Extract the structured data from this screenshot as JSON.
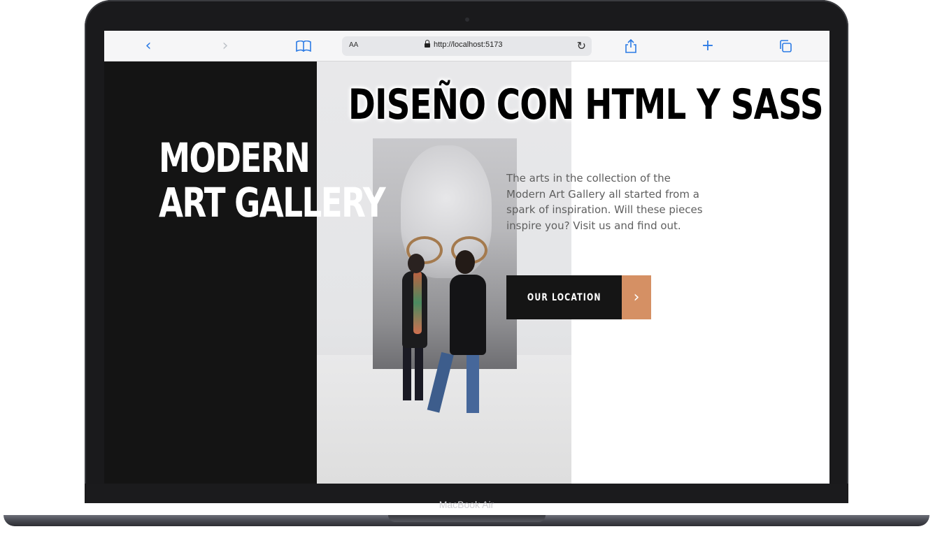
{
  "browser": {
    "back_icon": "‹",
    "forward_icon": "›",
    "reader_icon": "book-icon",
    "aa_label": "AA",
    "url": "http://localhost:5173",
    "reload_icon": "↻",
    "share_icon": "share-icon",
    "new_tab_icon": "+",
    "tabs_icon": "tabs-icon"
  },
  "overlay": {
    "title": "DISEÑO CON HTML Y SASS"
  },
  "hero": {
    "title_line1": "MODERN",
    "title_line2": "ART GALLERY",
    "description": "The arts in the collection of the Modern Art Gallery all started from a spark of inspiration. Will these pieces inspire you? Visit us and find out.",
    "cta_label": "OUR LOCATION",
    "cta_arrow": "›"
  },
  "device": {
    "brand": "MacBook Air"
  },
  "colors": {
    "dark_panel": "#141414",
    "accent": "#d59064",
    "text_muted": "#5f5f5f",
    "link_blue": "#2c7be5"
  }
}
